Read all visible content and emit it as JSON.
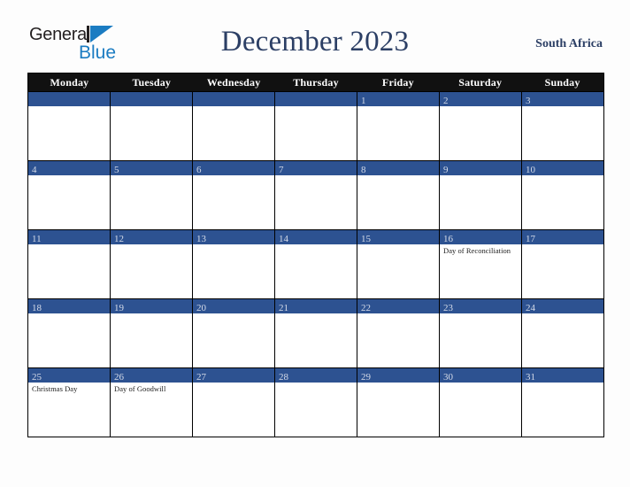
{
  "logo": {
    "text_primary": "General",
    "text_secondary": "Blue",
    "triangle_icon": "triangle-icon",
    "brand_blue": "#1b7cc2",
    "brand_dark": "#231f20"
  },
  "header": {
    "title": "December 2023",
    "country": "South Africa",
    "title_color": "#2c3f65"
  },
  "calendar": {
    "month": "December",
    "year": "2023",
    "week_start": "Monday",
    "accent_color": "#2d5291",
    "header_bg": "#111111",
    "day_headers": [
      "Monday",
      "Tuesday",
      "Wednesday",
      "Thursday",
      "Friday",
      "Saturday",
      "Sunday"
    ],
    "weeks": [
      [
        {
          "date": "",
          "event": ""
        },
        {
          "date": "",
          "event": ""
        },
        {
          "date": "",
          "event": ""
        },
        {
          "date": "",
          "event": ""
        },
        {
          "date": "1",
          "event": ""
        },
        {
          "date": "2",
          "event": ""
        },
        {
          "date": "3",
          "event": ""
        }
      ],
      [
        {
          "date": "4",
          "event": ""
        },
        {
          "date": "5",
          "event": ""
        },
        {
          "date": "6",
          "event": ""
        },
        {
          "date": "7",
          "event": ""
        },
        {
          "date": "8",
          "event": ""
        },
        {
          "date": "9",
          "event": ""
        },
        {
          "date": "10",
          "event": ""
        }
      ],
      [
        {
          "date": "11",
          "event": ""
        },
        {
          "date": "12",
          "event": ""
        },
        {
          "date": "13",
          "event": ""
        },
        {
          "date": "14",
          "event": ""
        },
        {
          "date": "15",
          "event": ""
        },
        {
          "date": "16",
          "event": "Day of Reconciliation"
        },
        {
          "date": "17",
          "event": ""
        }
      ],
      [
        {
          "date": "18",
          "event": ""
        },
        {
          "date": "19",
          "event": ""
        },
        {
          "date": "20",
          "event": ""
        },
        {
          "date": "21",
          "event": ""
        },
        {
          "date": "22",
          "event": ""
        },
        {
          "date": "23",
          "event": ""
        },
        {
          "date": "24",
          "event": ""
        }
      ],
      [
        {
          "date": "25",
          "event": "Christmas Day"
        },
        {
          "date": "26",
          "event": "Day of Goodwill"
        },
        {
          "date": "27",
          "event": ""
        },
        {
          "date": "28",
          "event": ""
        },
        {
          "date": "29",
          "event": ""
        },
        {
          "date": "30",
          "event": ""
        },
        {
          "date": "31",
          "event": ""
        }
      ]
    ]
  }
}
